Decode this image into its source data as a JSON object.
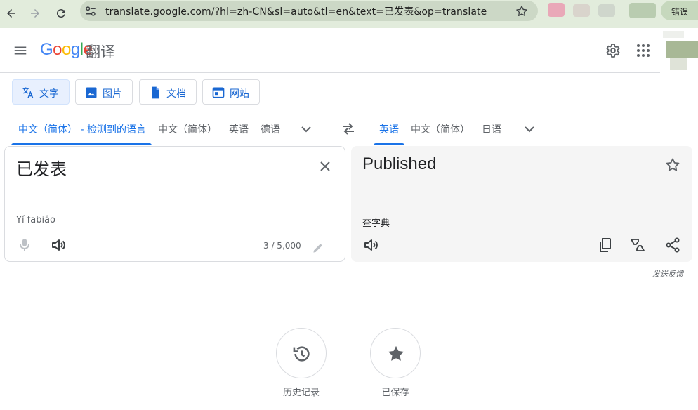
{
  "browser": {
    "url": "translate.google.com/?hl=zh-CN&sl=auto&tl=en&text=已发表&op=translate",
    "error_button_label": "错误"
  },
  "header": {
    "logo": "Google",
    "product_name": "翻译"
  },
  "modes": [
    {
      "label": "文字",
      "icon": "translate-icon",
      "active": true
    },
    {
      "label": "图片",
      "icon": "image-icon",
      "active": false
    },
    {
      "label": "文档",
      "icon": "document-icon",
      "active": false
    },
    {
      "label": "网站",
      "icon": "website-icon",
      "active": false
    }
  ],
  "source_languages": {
    "detected": "中文（简体） - 检测到的语言",
    "options": [
      "中文（简体）",
      "英语",
      "德语"
    ]
  },
  "target_languages": {
    "selected": "英语",
    "options": [
      "中文（简体）",
      "日语"
    ]
  },
  "source": {
    "text": "已发表",
    "transliteration": "Yǐ fābiǎo",
    "char_count": "3 / 5,000"
  },
  "target": {
    "text": "Published",
    "dictionary_link": "查字典"
  },
  "feedback_label": "发送反馈",
  "bottom_buttons": {
    "history_label": "历史记录",
    "saved_label": "已保存"
  },
  "colors": {
    "accent": "#1a73e8",
    "chrome_bg": "#e2ecdc",
    "active_chip_bg": "#e8f0fe"
  }
}
